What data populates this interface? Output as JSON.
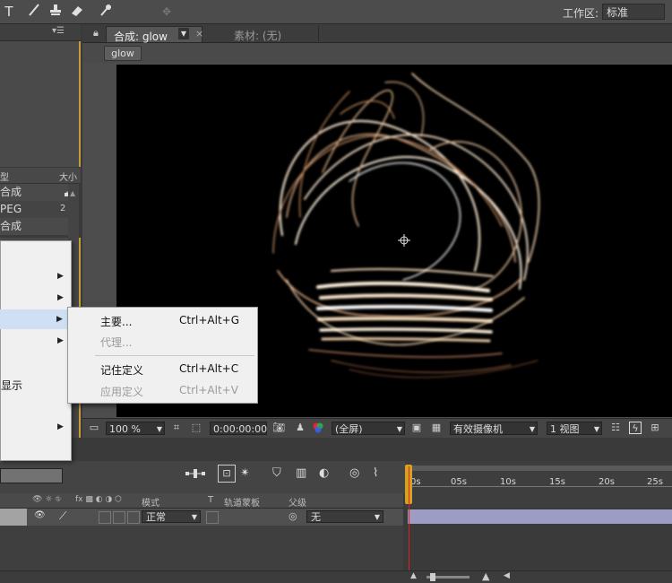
{
  "toolbar": {
    "workspace_label": "工作区:",
    "workspace_value": "标准"
  },
  "project": {
    "col_type": "型",
    "col_size": "大小",
    "rows": [
      "合成",
      "PEG",
      "合成"
    ],
    "row2_size": "2"
  },
  "comp": {
    "tab_active": "合成: glow",
    "tab_footage": "素材: (无)",
    "breadcrumb": "glow"
  },
  "viewer_controls": {
    "zoom": "100 %",
    "timecode": "0:00:00:00",
    "resolution": "(全屏)",
    "camera": "有效摄像机",
    "views": "1 视图"
  },
  "context_menu": {
    "left_partial_item": "显示",
    "submenu": [
      {
        "label": "主要...",
        "shortcut": "Ctrl+Alt+G",
        "enabled": true
      },
      {
        "label": "代理...",
        "shortcut": "",
        "enabled": false
      },
      {
        "label": "记住定义",
        "shortcut": "Ctrl+Alt+C",
        "enabled": true
      },
      {
        "label": "应用定义",
        "shortcut": "Ctrl+Alt+V",
        "enabled": false
      }
    ]
  },
  "timeline": {
    "col_mode": "模式",
    "col_t": "T",
    "col_track_matte": "轨道蒙板",
    "col_parent": "父级",
    "layer_mode": "正常",
    "layer_parent": "无",
    "ruler_ticks": [
      "0s",
      "05s",
      "10s",
      "15s",
      "20s",
      "25s"
    ]
  }
}
